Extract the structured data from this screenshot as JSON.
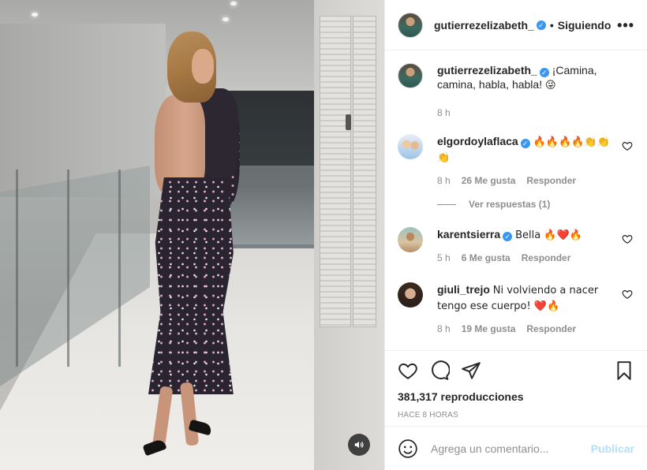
{
  "post": {
    "author": "gutierrezelizabeth_",
    "follow_status": "Siguiendo",
    "separator": "•",
    "more_glyph": "•••",
    "verified_glyph": "✓",
    "caption_line1": "¡Camina,",
    "caption_line2": "camina, habla, habla!",
    "caption_emoji": "😜",
    "caption_time": "8 h"
  },
  "comments": [
    {
      "user": "elgordoylaflaca",
      "text": "🔥🔥🔥🔥👏👏👏",
      "time": "8 h",
      "likes": "26 Me gusta",
      "reply": "Responder",
      "view_replies": "Ver respuestas (1)"
    },
    {
      "user": "karentsierra",
      "text": "Bella 🔥❤️🔥",
      "time": "5 h",
      "likes": "6 Me gusta",
      "reply": "Responder"
    },
    {
      "user": "giuli_trejo",
      "text": "Ni volviendo a nacer tengo ese cuerpo! ❤️🔥",
      "time": "8 h",
      "likes": "19 Me gusta",
      "reply": "Responder"
    }
  ],
  "stats": {
    "views": "381,317 reproducciones",
    "time_ago": "HACE 8 HORAS"
  },
  "add_comment": {
    "placeholder": "Agrega un comentario...",
    "publish_label": "Publicar"
  },
  "icons": {
    "like": "heart-icon",
    "comment": "comment-icon",
    "share": "paper-plane-icon",
    "save": "bookmark-icon",
    "emoji": "smiley-icon",
    "mute": "speaker-icon",
    "more": "more-dots-icon"
  },
  "colors": {
    "verified": "#3897f0",
    "publish_disabled": "#b2dffc",
    "secondary_text": "#8e8e8e",
    "primary_text": "#262626"
  }
}
